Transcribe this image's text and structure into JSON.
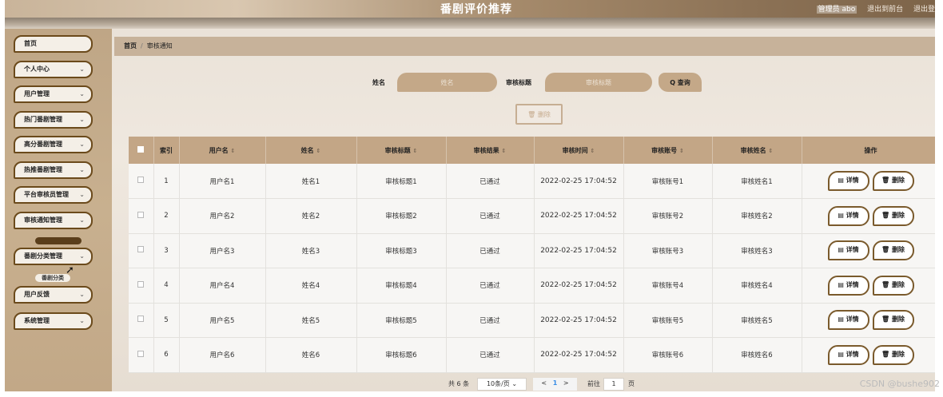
{
  "header": {
    "title": "番剧评价推荐",
    "user_text": "管理员 abo",
    "back_front": "退出到前台",
    "logout": "退出登"
  },
  "sidebar": {
    "items": [
      {
        "label": "首页",
        "chevron": ""
      },
      {
        "label": "个人中心",
        "chevron": "⌄"
      },
      {
        "label": "用户管理",
        "chevron": "⌄"
      },
      {
        "label": "热门番剧管理",
        "chevron": "⌄"
      },
      {
        "label": "高分番剧管理",
        "chevron": "⌄"
      },
      {
        "label": "热推番剧管理",
        "chevron": "⌄"
      },
      {
        "label": "平台审核员管理",
        "chevron": "⌄"
      },
      {
        "label": "审核通知管理",
        "chevron": "⌄"
      },
      {
        "label": "番剧分类管理",
        "chevron": "⌄"
      },
      {
        "label": "用户反馈",
        "chevron": "⌄"
      },
      {
        "label": "系统管理",
        "chevron": "⌄"
      }
    ],
    "submenu_label": "番剧分类"
  },
  "breadcrumb": {
    "home": "首页",
    "separator": "/",
    "current": "审核通知"
  },
  "search": {
    "name_label": "姓名",
    "name_placeholder": "姓名",
    "title_label": "审核标题",
    "title_placeholder": "审核标题",
    "query_button": "Q 查询",
    "delete_button": "🗑 删除"
  },
  "table": {
    "headers": {
      "index": "索引",
      "username": "用户名",
      "name": "姓名",
      "title": "审核标题",
      "result": "审核结果",
      "time": "审核时间",
      "account": "审核账号",
      "reviewer": "审核姓名",
      "actions": "操作"
    },
    "sort_icon": "⇕",
    "detail_button": "▤ 详情",
    "delete_button": "🗑 删除",
    "rows": [
      {
        "index": "1",
        "username": "用户名1",
        "name": "姓名1",
        "title": "审核标题1",
        "result": "已通过",
        "time": "2022-02-25 17:04:52",
        "account": "审核账号1",
        "reviewer": "审核姓名1"
      },
      {
        "index": "2",
        "username": "用户名2",
        "name": "姓名2",
        "title": "审核标题2",
        "result": "已通过",
        "time": "2022-02-25 17:04:52",
        "account": "审核账号2",
        "reviewer": "审核姓名2"
      },
      {
        "index": "3",
        "username": "用户名3",
        "name": "姓名3",
        "title": "审核标题3",
        "result": "已通过",
        "time": "2022-02-25 17:04:52",
        "account": "审核账号3",
        "reviewer": "审核姓名3"
      },
      {
        "index": "4",
        "username": "用户名4",
        "name": "姓名4",
        "title": "审核标题4",
        "result": "已通过",
        "time": "2022-02-25 17:04:52",
        "account": "审核账号4",
        "reviewer": "审核姓名4"
      },
      {
        "index": "5",
        "username": "用户名5",
        "name": "姓名5",
        "title": "审核标题5",
        "result": "已通过",
        "time": "2022-02-25 17:04:52",
        "account": "审核账号5",
        "reviewer": "审核姓名5"
      },
      {
        "index": "6",
        "username": "用户名6",
        "name": "姓名6",
        "title": "审核标题6",
        "result": "已通过",
        "time": "2022-02-25 17:04:52",
        "account": "审核账号6",
        "reviewer": "审核姓名6"
      }
    ]
  },
  "pagination": {
    "total": "共 6 条",
    "page_size": "10条/页",
    "prev": "<",
    "current": "1",
    "next": ">",
    "goto_label": "前往",
    "goto_value": "1",
    "page_suffix": "页"
  },
  "watermark": "CSDN @bushe902",
  "colors": {
    "accent": "#c3a686",
    "border": "#6b4a1b",
    "panel": "#f7f6f4"
  }
}
